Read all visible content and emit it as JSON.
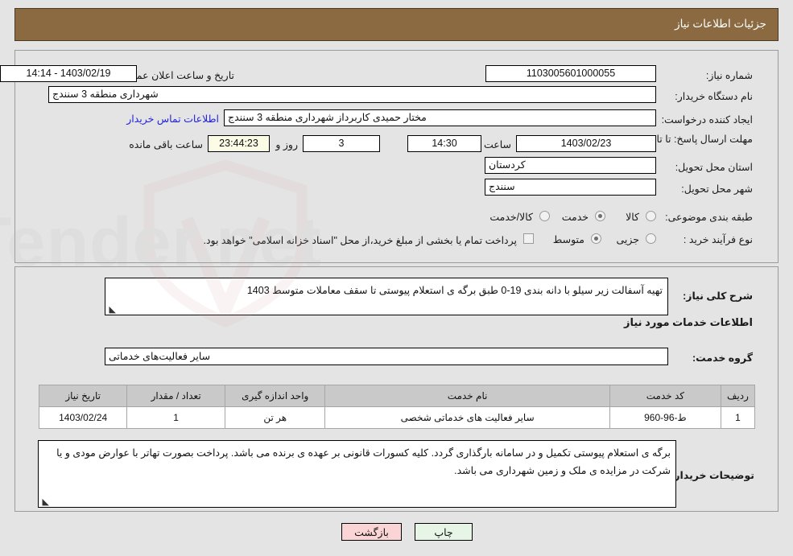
{
  "header": {
    "title": "جزئیات اطلاعات نیاز"
  },
  "form": {
    "need_number_label": "شماره نیاز:",
    "need_number_value": "1103005601000055",
    "buyer_org_label": "نام دستگاه خریدار:",
    "buyer_org_value": "شهرداری منطقه 3 سنندج",
    "creator_label": "ایجاد کننده درخواست:",
    "creator_value": "مختار حمیدی کاربرداز شهرداری منطقه 3 سنندج",
    "deadline_label": "مهلت ارسال پاسخ: تا تاریخ:",
    "deadline_date": "1403/02/23",
    "deadline_hour_label": "ساعت",
    "deadline_hour": "14:30",
    "remaining_days": "3",
    "remaining_days_label": "روز و",
    "remaining_time": "23:44:23",
    "remaining_time_label": "ساعت باقی مانده",
    "announce_label": "تاریخ و ساعت اعلان عمومی:",
    "announce_value": "1403/02/19 - 14:14",
    "contact_link": "اطلاعات تماس خریدار",
    "province_label": "استان محل تحویل:",
    "province_value": "کردستان",
    "city_label": "شهر محل تحویل:",
    "city_value": "سنندج",
    "category_label": "طبقه بندی موضوعی:",
    "category_options": [
      {
        "label": "کالا",
        "selected": false
      },
      {
        "label": "خدمت",
        "selected": true
      },
      {
        "label": "کالا/خدمت",
        "selected": false
      }
    ],
    "process_label": "نوع فرآیند خرید :",
    "process_options": [
      {
        "label": "جزیی",
        "selected": false
      },
      {
        "label": "متوسط",
        "selected": true
      }
    ],
    "treasury_checkbox_label": "پرداخت تمام یا بخشی از مبلغ خرید،از محل \"اسناد خزانه اسلامی\" خواهد بود.",
    "treasury_checked": false
  },
  "need": {
    "summary_label": "شرح کلی نیاز:",
    "summary_value": "تهیه آسفالت زیر سیلو  با دانه بندی 19-0  طبق برگه ی استعلام پیوستی تا سقف معاملات متوسط 1403",
    "services_heading": "اطلاعات خدمات مورد نیاز",
    "service_group_label": "گروه خدمت:",
    "service_group_value": "سایر فعالیت‌های خدماتی"
  },
  "table": {
    "columns": [
      "ردیف",
      "کد خدمت",
      "نام خدمت",
      "واحد اندازه گیری",
      "تعداد / مقدار",
      "تاریخ نیاز"
    ],
    "rows": [
      {
        "row": "1",
        "code": "ط-96-960",
        "name": "سایر فعالیت های خدماتی شخصی",
        "unit": "هر تن",
        "quantity": "1",
        "date": "1403/02/24"
      }
    ]
  },
  "notes": {
    "label": "توضیحات خریدار:",
    "value": "برگه ی استعلام پیوستی تکمیل و در سامانه بارگذاری گردد. کلیه کسورات قانونی بر عهده ی برنده می باشد. پرداخت بصورت تهاتر با عوارض مودی و یا شرکت در مزایده ی ملک و زمین شهرداری می باشد."
  },
  "footer": {
    "back_label": "بازگشت",
    "print_label": "چاپ"
  },
  "watermark": {
    "text": "AriaTender.net"
  },
  "colors": {
    "header_bg": "#8b6a42",
    "page_bg": "#e4e4e4",
    "link": "#2222dd",
    "back_btn": "#fbd5d5",
    "print_btn": "#e6f5e6",
    "timer_bg": "#fbfbe6"
  }
}
